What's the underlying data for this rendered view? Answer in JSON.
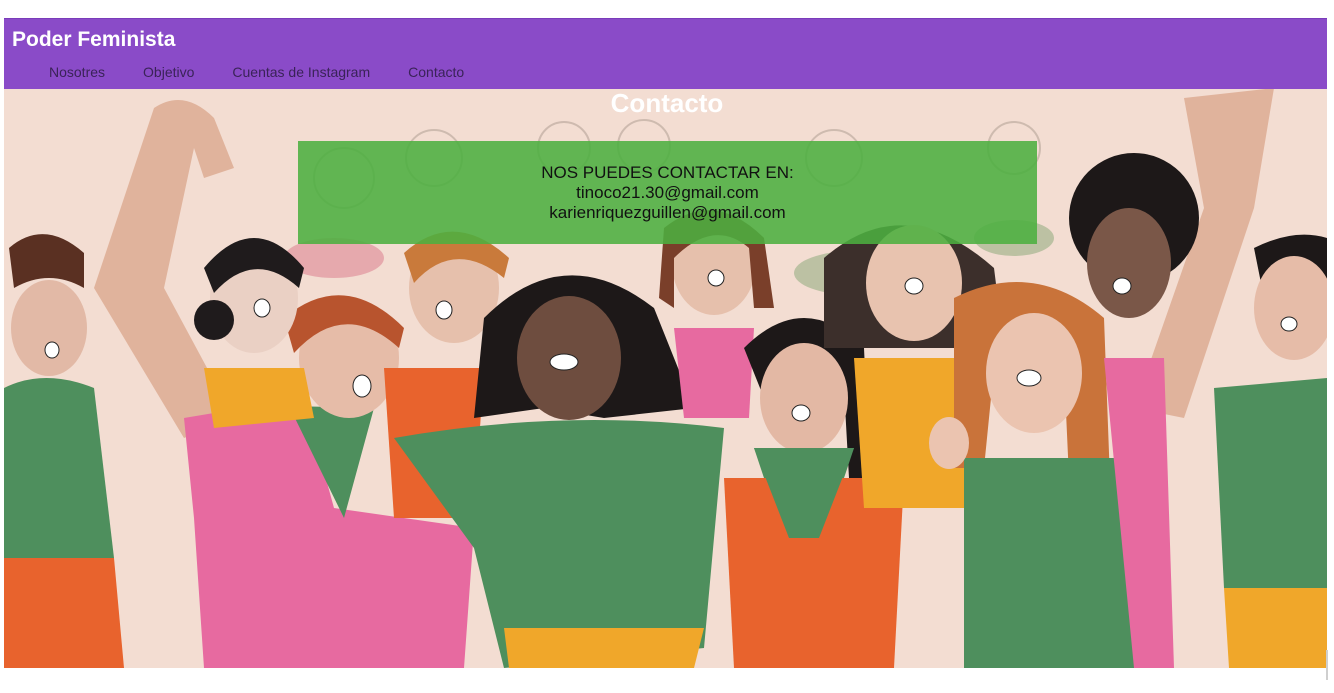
{
  "header": {
    "brand": "Poder Feminista",
    "nav": [
      {
        "label": "Nosotres"
      },
      {
        "label": "Objetivo"
      },
      {
        "label": "Cuentas de Instagram"
      },
      {
        "label": "Contacto"
      }
    ],
    "background_color": "#8a4bc8"
  },
  "main": {
    "section_title": "Contacto",
    "contact": {
      "heading": "NOS PUEDES CONTACTAR EN:",
      "emails": [
        "tinoco21.30@gmail.com",
        "karienriquezguillen@gmail.com"
      ],
      "box_color": "#4caf40"
    },
    "hero_image": "illustration-women-protesting"
  }
}
